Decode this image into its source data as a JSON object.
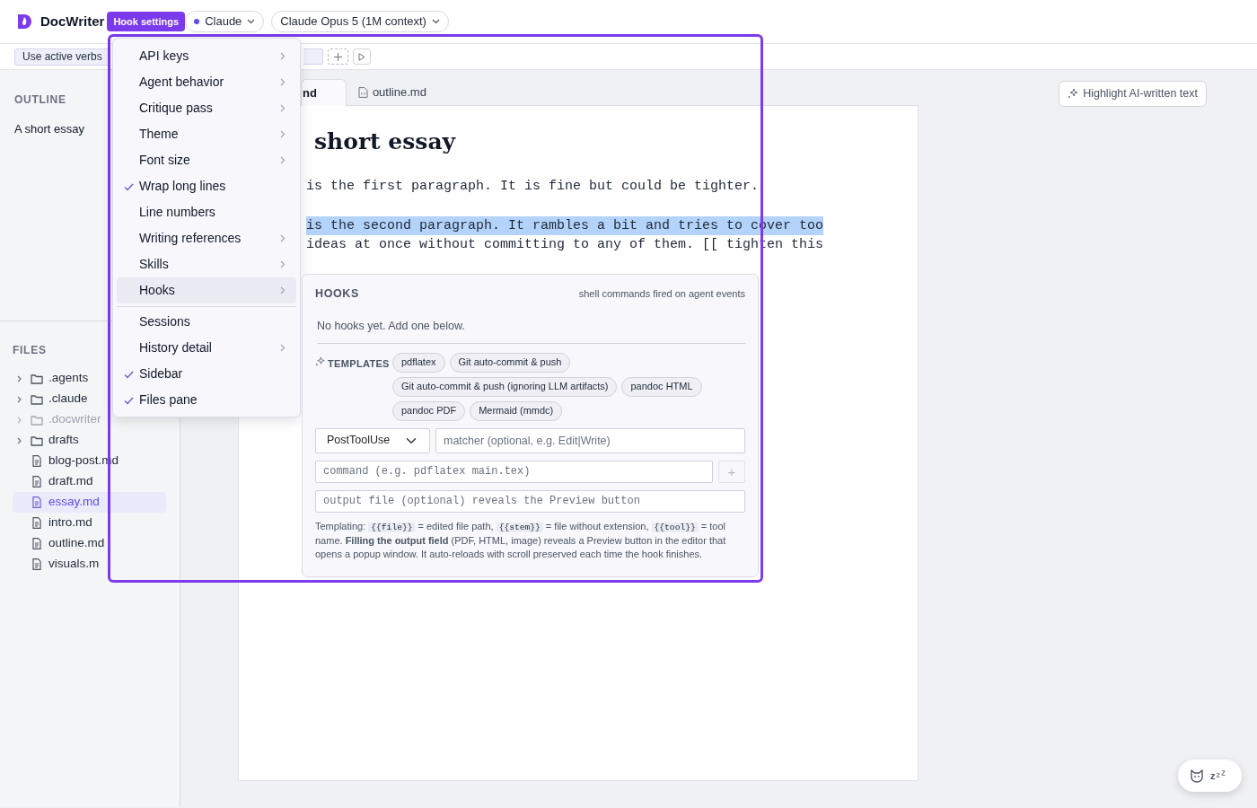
{
  "app": {
    "name": "DocWriter",
    "badge": "Hook settings"
  },
  "provider": {
    "label": "Claude"
  },
  "model": {
    "label": "Claude Opus 5 (1M context)"
  },
  "toolbar": {
    "chip": "Use active verbs"
  },
  "outline": {
    "title": "OUTLINE",
    "items": [
      {
        "label": "A short essay"
      }
    ]
  },
  "files": {
    "title": "FILES",
    "items": [
      {
        "label": ".agents",
        "kind": "folder",
        "dimmed": false,
        "selected": false
      },
      {
        "label": ".claude",
        "kind": "folder",
        "dimmed": false,
        "selected": false
      },
      {
        "label": ".docwriter",
        "kind": "folder",
        "dimmed": true,
        "selected": false
      },
      {
        "label": "drafts",
        "kind": "folder",
        "dimmed": false,
        "selected": false
      },
      {
        "label": "blog-post.md",
        "kind": "file",
        "dimmed": false,
        "selected": false
      },
      {
        "label": "draft.md",
        "kind": "file",
        "dimmed": false,
        "selected": false
      },
      {
        "label": "essay.md",
        "kind": "file",
        "dimmed": false,
        "selected": true
      },
      {
        "label": "intro.md",
        "kind": "file",
        "dimmed": false,
        "selected": false
      },
      {
        "label": "outline.md",
        "kind": "file",
        "dimmed": false,
        "selected": false
      },
      {
        "label": "visuals.m",
        "kind": "file",
        "dimmed": false,
        "selected": false
      }
    ]
  },
  "tabs": [
    {
      "label": "nd",
      "selected": true
    },
    {
      "label": "outline.md",
      "selected": false
    }
  ],
  "document": {
    "heading": "short essay",
    "paragraphs": [
      {
        "lines": [
          {
            "text": "is the first paragraph. It is fine but could be tighter.",
            "selected": false
          }
        ]
      },
      {
        "lines": [
          {
            "text": "is the second paragraph. It rambles a bit and tries to cover too",
            "selected": true
          },
          {
            "text": "ideas at once without committing to any of them. [[ tighten this",
            "selected": false
          }
        ]
      }
    ]
  },
  "highlight_button": "Highlight AI-written text",
  "mascot": {
    "sleep": [
      "z",
      "z",
      "z"
    ]
  },
  "menu": {
    "groups": [
      [
        {
          "label": "API keys",
          "submenu": true,
          "checked": false,
          "selected": false
        },
        {
          "label": "Agent behavior",
          "submenu": true,
          "checked": false,
          "selected": false
        },
        {
          "label": "Critique pass",
          "submenu": true,
          "checked": false,
          "selected": false
        },
        {
          "label": "Theme",
          "submenu": true,
          "checked": false,
          "selected": false
        },
        {
          "label": "Font size",
          "submenu": true,
          "checked": false,
          "selected": false
        },
        {
          "label": "Wrap long lines",
          "submenu": false,
          "checked": true,
          "selected": false
        },
        {
          "label": "Line numbers",
          "submenu": false,
          "checked": false,
          "selected": false
        },
        {
          "label": "Writing references",
          "submenu": true,
          "checked": false,
          "selected": false
        },
        {
          "label": "Skills",
          "submenu": true,
          "checked": false,
          "selected": false
        },
        {
          "label": "Hooks",
          "submenu": true,
          "checked": false,
          "selected": true
        }
      ],
      [
        {
          "label": "Sessions",
          "submenu": false,
          "checked": false,
          "selected": false
        },
        {
          "label": "History detail",
          "submenu": true,
          "checked": false,
          "selected": false
        },
        {
          "label": "Sidebar",
          "submenu": false,
          "checked": true,
          "selected": false
        },
        {
          "label": "Files pane",
          "submenu": false,
          "checked": true,
          "selected": false
        }
      ]
    ]
  },
  "hooks": {
    "title": "HOOKS",
    "subtitle": "shell commands fired on agent events",
    "empty": "No hooks yet. Add one below.",
    "templates_label": "TEMPLATES",
    "templates": [
      "pdflatex",
      "Git auto-commit & push",
      "Git auto-commit & push (ignoring LLM artifacts)",
      "pandoc HTML",
      "pandoc PDF",
      "Mermaid (mmdc)"
    ],
    "event": "PostToolUse",
    "matcher": {
      "placeholder": "matcher (optional, e.g. Edit|Write)"
    },
    "command": {
      "placeholder": "command (e.g. pdflatex main.tex)"
    },
    "add_button": "+",
    "output": {
      "placeholder": "output file (optional) reveals the Preview button"
    },
    "help": [
      {
        "kind": "text",
        "text": "Templating: "
      },
      {
        "kind": "code",
        "text": "{{file}}"
      },
      {
        "kind": "text",
        "text": " = edited file path, "
      },
      {
        "kind": "code",
        "text": "{{stem}}"
      },
      {
        "kind": "text",
        "text": " = file without extension, "
      },
      {
        "kind": "code",
        "text": "{{tool}}"
      },
      {
        "kind": "text",
        "text": " = tool name. "
      },
      {
        "kind": "bold",
        "text": "Filling the output field"
      },
      {
        "kind": "text",
        "text": " (PDF, HTML, image) reveals a Preview button in the editor that opens a popup window. It auto-reloads with scroll preserved each time the hook finishes."
      }
    ]
  }
}
